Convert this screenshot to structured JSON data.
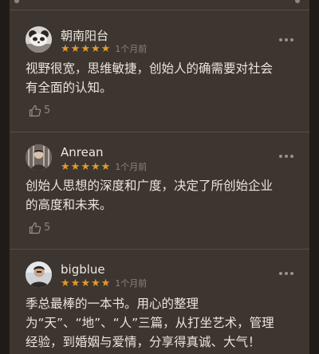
{
  "reviews": [
    {
      "name": "朝南阳台",
      "stars": [
        "★",
        "★",
        "★",
        "★",
        "★"
      ],
      "time": "1个月前",
      "lines": [
        "视野很宽，思维敏捷，创始人的确需要对社会",
        "有全面的认知。"
      ],
      "likes": "5"
    },
    {
      "name": "Anrean",
      "stars": [
        "★",
        "★",
        "★",
        "★",
        "★"
      ],
      "time": "1个月前",
      "lines": [
        "创始人思想的深度和广度，决定了所创始企业",
        "的高度和未来。"
      ],
      "likes": "5"
    },
    {
      "name": "bigblue",
      "stars": [
        "★",
        "★",
        "★",
        "★",
        "★"
      ],
      "time": "1个月前",
      "lines": [
        "季总最棒的一本书。用心的整理",
        "为“天”、“地”、“人”三篇，从打坐艺术，管理",
        "经验，到婚姻与爱情，分享得真诚、大气！"
      ]
    }
  ],
  "colors": {
    "background": "#3d352f",
    "star": "#e39a2c",
    "text": "#ece5dd",
    "muted": "#8e847b"
  }
}
